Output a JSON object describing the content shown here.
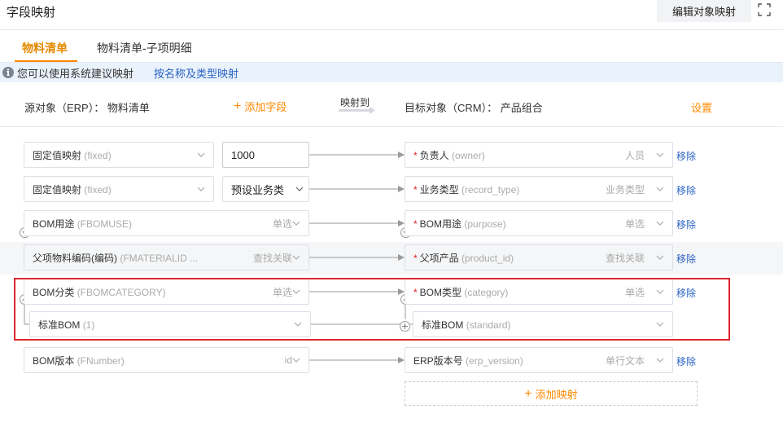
{
  "page": {
    "title": "字段映射",
    "edit_button": "编辑对象映射"
  },
  "tabs": [
    {
      "label": "物料清单"
    },
    {
      "label": "物料清单-子项明细"
    }
  ],
  "notice": {
    "text": "您可以使用系统建议映射",
    "link": "按名称及类型映射"
  },
  "header": {
    "source": "源对象（ERP）： 物料清单",
    "add_field": "添加字段",
    "map_to": "映射到",
    "target": "目标对象（CRM）： 产品组合",
    "settings": "设置"
  },
  "rows": [
    {
      "src_label": "固定值映射",
      "src_hint": "(fixed)",
      "value": "1000",
      "tgt_label": "负责人",
      "tgt_hint": "(owner)",
      "tgt_type": "人员",
      "remove": "移除"
    },
    {
      "src_label": "固定值映射",
      "src_hint": "(fixed)",
      "value": "预设业务类",
      "tgt_label": "业务类型",
      "tgt_hint": "(record_type)",
      "tgt_type": "业务类型",
      "remove": "移除"
    },
    {
      "src_label": "BOM用途",
      "src_hint": "(FBOMUSE)",
      "src_type": "单选",
      "tgt_label": "BOM用途",
      "tgt_hint": "(purpose)",
      "tgt_type": "单选",
      "remove": "移除"
    },
    {
      "src_label": "父项物料编码(编码)",
      "src_hint": "(FMATERIALID ...",
      "src_type": "查找关联",
      "tgt_label": "父项产品",
      "tgt_hint": "(product_id)",
      "tgt_type": "查找关联",
      "remove": "移除"
    },
    {
      "src_label": "BOM分类",
      "src_hint": "(FBOMCATEGORY)",
      "src_type": "单选",
      "tgt_label": "BOM类型",
      "tgt_hint": "(category)",
      "tgt_type": "单选",
      "remove": "移除"
    },
    {
      "src_label": "BOM版本",
      "src_hint": "(FNumber)",
      "src_type": "id",
      "tgt_label": "ERP版本号",
      "tgt_hint": "(erp_version)",
      "tgt_type": "单行文本",
      "remove": "移除"
    }
  ],
  "option_row": {
    "src_label": "标准BOM",
    "src_hint": "(1)",
    "tgt_label": "标准BOM",
    "tgt_hint": "(standard)"
  },
  "required_mark": "*",
  "add_mapping": "添加映射",
  "colors": {
    "accent": "#ff8800",
    "link": "#2b63c5",
    "highlight": "#e0252c"
  },
  "icons": [
    "info-icon",
    "fullscreen-icon",
    "plus-icon",
    "chevron-down-icon",
    "arrow-right-icon",
    "collapse-icon",
    "expand-icon"
  ]
}
